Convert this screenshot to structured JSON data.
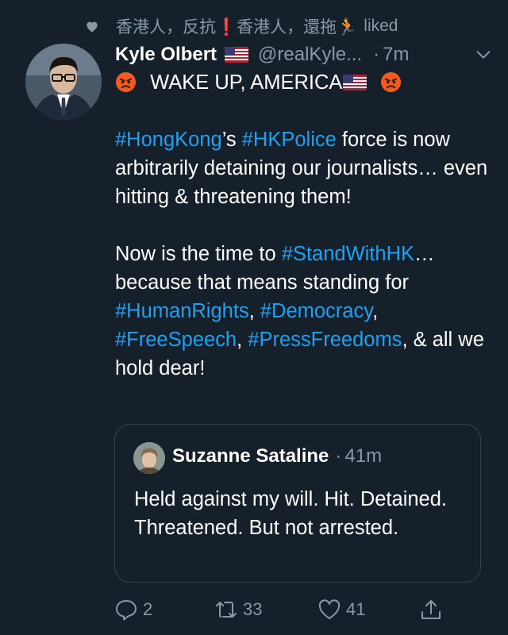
{
  "social_context": {
    "user": "香港人，反抗❗香港人，還拖🏃",
    "action": "liked"
  },
  "tweet": {
    "author_name": "Kyle Olbert",
    "handle": "@realKyle...",
    "dot": "·",
    "time": "7m",
    "line1": "WAKE UP, AMERICA",
    "p2": {
      "tag1": "#HongKong",
      "t1": "’s ",
      "tag2": "#HKPolice",
      "t2": " force is now arbitrarily detaining our journalists… even hitting & threatening them!"
    },
    "p3": {
      "t1": "Now is the time to ",
      "tag1": "#StandWithHK",
      "t2": "… because that means standing for ",
      "tag2": "#HumanRights",
      "t3": ", ",
      "tag3": "#Democracy",
      "t4": ", ",
      "tag4": "#FreeSpeech",
      "t5": ", ",
      "tag5": "#PressFreedoms",
      "t6": ", & all we hold dear!"
    }
  },
  "quote": {
    "author_name": "Suzanne Sataline",
    "dot": "·",
    "time": "41m",
    "text": "Held against my will. Hit. Detained. Threatened. But not arrested."
  },
  "actions": {
    "reply_count": "2",
    "retweet_count": "33",
    "like_count": "41"
  },
  "colors": {
    "background": "#15202b",
    "secondary_text": "#8899a6",
    "link": "#1da1f2",
    "border": "#38444d"
  },
  "icons": [
    "heart-icon",
    "us-flag-icon",
    "angry-face-icon",
    "chevron-down-icon",
    "reply-icon",
    "retweet-icon",
    "like-icon",
    "share-icon"
  ]
}
